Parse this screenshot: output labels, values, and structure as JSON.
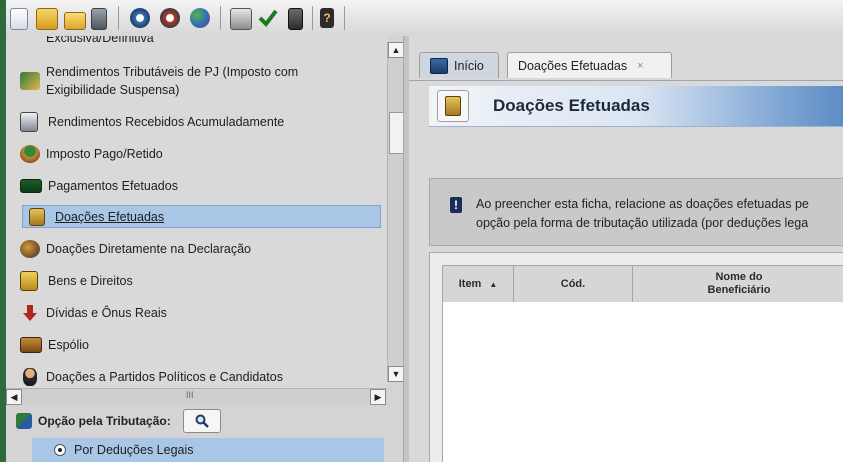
{
  "toolbar": {
    "icons": [
      "new-file-icon",
      "open-folder-icon",
      "folder-icon",
      "trash-icon",
      "transmit-icon",
      "receive-icon",
      "globe-icon",
      "print-icon",
      "check-icon",
      "calculator-icon",
      "help-icon"
    ]
  },
  "sidebar": {
    "items": [
      {
        "label": "Exclusiva/Definitiva",
        "icon": "document-icon",
        "selected": false
      },
      {
        "label": "Rendimentos Tributáveis de PJ (Imposto com",
        "label2": "Exigibilidade Suspensa)",
        "icon": "building-money-icon",
        "selected": false
      },
      {
        "label": "Rendimentos Recebidos Acumuladamente",
        "icon": "document-clock-icon",
        "selected": false
      },
      {
        "label": "Imposto Pago/Retido",
        "icon": "hand-money-icon",
        "selected": false
      },
      {
        "label": "Pagamentos Efetuados",
        "icon": "money-bill-icon",
        "selected": false
      },
      {
        "label": "Doações Efetuadas",
        "icon": "donation-box-icon",
        "selected": true
      },
      {
        "label": "Doações Diretamente na Declaração",
        "icon": "people-icon",
        "selected": false
      },
      {
        "label": "Bens e Direitos",
        "icon": "safe-icon",
        "selected": false
      },
      {
        "label": "Dívidas e Ônus Reais",
        "icon": "arrow-down-icon",
        "selected": false
      },
      {
        "label": "Espólio",
        "icon": "chest-icon",
        "selected": false
      },
      {
        "label": "Doações a Partidos Políticos e Candidatos",
        "icon": "candidate-icon",
        "selected": false
      }
    ],
    "opcao_label": "Opção pela Tributação:",
    "radio_label": "Por Deduções Legais",
    "hscroll_grip": "III"
  },
  "tabs": [
    {
      "label": "Início"
    },
    {
      "label": "Doações Efetuadas",
      "close": "×"
    }
  ],
  "panel": {
    "title": "Doações Efetuadas",
    "info_line1": "Ao preencher esta ficha, relacione as doações efetuadas pe",
    "info_line2": "opção pela forma de tributação utilizada (por deduções lega"
  },
  "grid": {
    "columns": [
      {
        "label": "Item",
        "sort": "▲"
      },
      {
        "label": "Cód."
      },
      {
        "label": "Nome do",
        "label2": "Beneficiário"
      }
    ]
  },
  "colors": {
    "selection": "#a9c6e6",
    "title_gradient_end": "#5d8cc4",
    "background": "#2f6b3a"
  }
}
